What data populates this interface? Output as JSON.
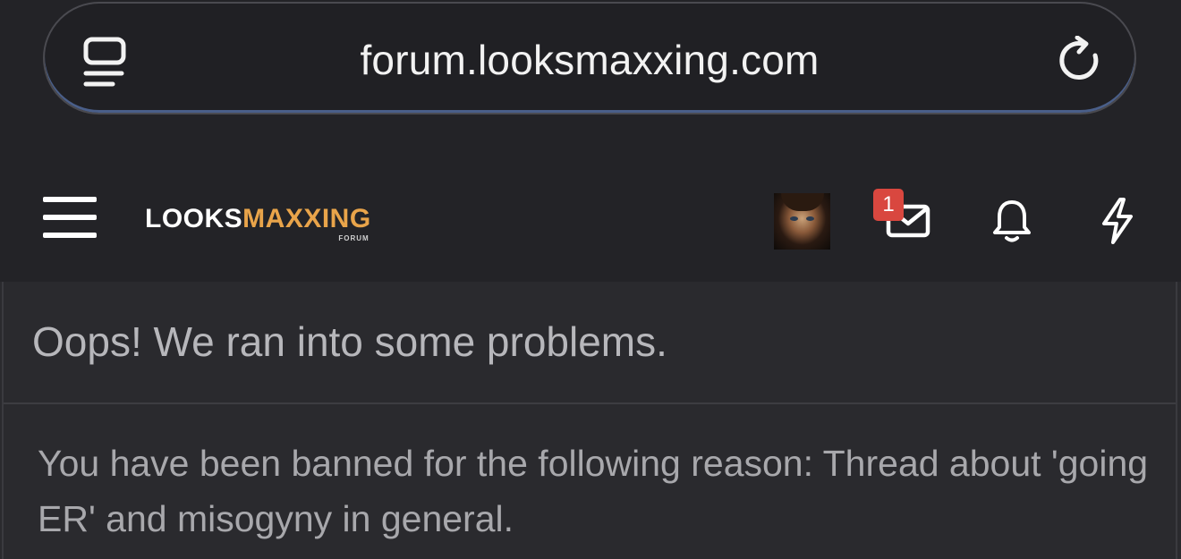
{
  "browser": {
    "url": "forum.looksmaxxing.com"
  },
  "header": {
    "logo_white": "LOOKS",
    "logo_orange": "MAXXING",
    "logo_sub": "FORUM",
    "inbox_badge": "1"
  },
  "error": {
    "title": "Oops! We ran into some problems.",
    "message": "You have been banned for the following reason: Thread about 'going ER' and misogyny in general."
  },
  "colors": {
    "background": "#232327",
    "logo_accent": "#e9a44a",
    "badge": "#d9473f"
  },
  "icons": [
    "tabs-icon",
    "reload-icon",
    "menu-icon",
    "mail-icon",
    "bell-icon",
    "bolt-icon"
  ]
}
